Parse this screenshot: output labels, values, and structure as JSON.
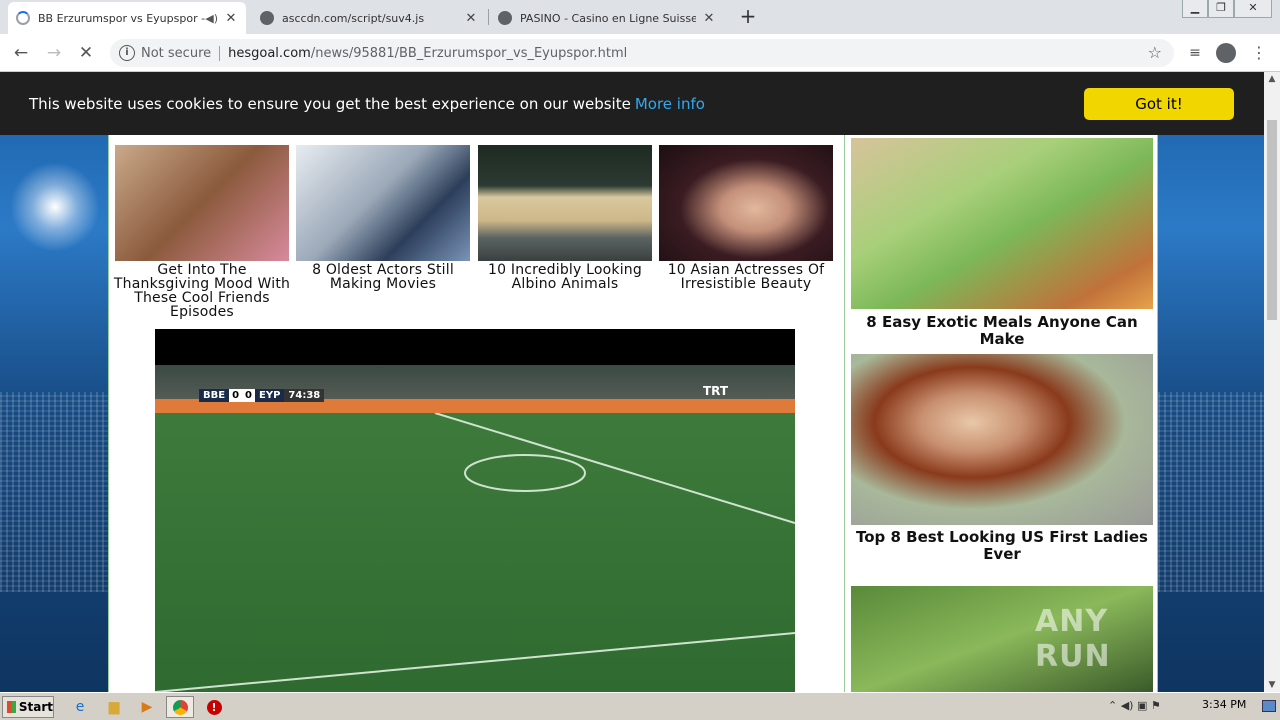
{
  "tabs": [
    {
      "title": "BB Erzurumspor vs Eyupspor - H",
      "icon": "loading-spinner-icon",
      "muted_icon": "speaker-icon"
    },
    {
      "title": "asccdn.com/script/suv4.js",
      "icon": "globe-icon"
    },
    {
      "title": "PASINO - Casino en Ligne Suisse - Su",
      "icon": "globe-icon"
    }
  ],
  "new_tab_label": "+",
  "address": {
    "security_label": "Not secure",
    "host": "hesgoal.com",
    "path": "/news/95881/BB_Erzurumspor_vs_Eyupspor.html"
  },
  "cookie_bar": {
    "message": "This website uses cookies to ensure you get the best experience on our website",
    "more_info": "More info",
    "button": "Got it!"
  },
  "thumbs": [
    {
      "caption": "Get Into The Thanksgiving Mood With These Cool Friends Episodes"
    },
    {
      "caption": "8 Oldest Actors Still Making Movies"
    },
    {
      "caption": "10 Incredibly Looking Albino Animals"
    },
    {
      "caption": "10 Asian Actresses Of Irresistible Beauty"
    }
  ],
  "right_ads": [
    {
      "caption": "8 Easy Exotic Meals Anyone Can Make"
    },
    {
      "caption": "Top 8 Best Looking US First Ladies Ever"
    }
  ],
  "scoreboard": {
    "home": "BBE",
    "home_score": "0",
    "away_score": "0",
    "away": "EYP",
    "time": "74:38",
    "broadcaster": "TRT"
  },
  "watermark": "ANY RUN",
  "taskbar": {
    "start": "Start",
    "clock": "3:34 PM"
  },
  "colors": {
    "cookie_bg": "#1f1f1f",
    "cookie_button": "#f1d600",
    "more_link": "#31a8f0",
    "pitch": "#3c7a3a"
  }
}
